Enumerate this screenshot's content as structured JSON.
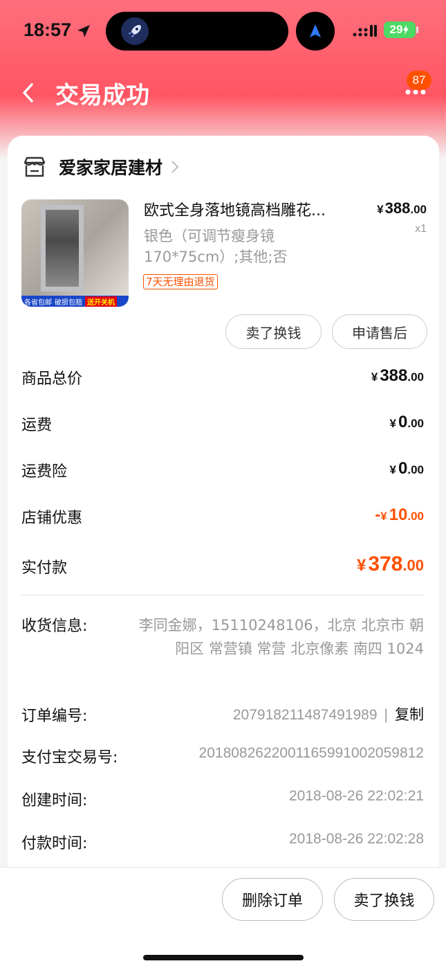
{
  "status_bar": {
    "time": "18:57",
    "battery": "29"
  },
  "header": {
    "title": "交易成功",
    "badge_count": "87"
  },
  "shop": {
    "name": "爱家家居建材"
  },
  "product": {
    "title": "欧式全身落地镜高档雕花...",
    "price_currency": "¥",
    "price_int": "388",
    "price_dec": ".00",
    "quantity": "x1",
    "spec": "银色（可调节瘦身镜170*75cm）;其他;否",
    "return_tag": "7天无理由退货",
    "image_strip": [
      "各省包邮",
      "破损包赔",
      "送开关机"
    ],
    "actions": {
      "sell": "卖了换钱",
      "after_sale": "申请售后"
    }
  },
  "fees": [
    {
      "label": "商品总价",
      "prefix": "",
      "currency": "¥",
      "int": "388",
      "dec": ".00"
    },
    {
      "label": "运费",
      "prefix": "",
      "currency": "¥",
      "int": "0",
      "dec": ".00"
    },
    {
      "label": "运费险",
      "prefix": "",
      "currency": "¥",
      "int": "0",
      "dec": ".00"
    },
    {
      "label": "店铺优惠",
      "prefix": "-",
      "currency": "¥",
      "int": "10",
      "dec": ".00"
    },
    {
      "label": "实付款",
      "prefix": "",
      "currency": "¥",
      "int": "378",
      "dec": ".00"
    }
  ],
  "info": {
    "address_label": "收货信息:",
    "address_value": "李同金娜，15110248106，北京 北京市 朝阳区 常营镇 常营 北京像素 南四 1024",
    "order_label": "订单编号:",
    "order_value": "207918211487491989",
    "copy_label": "复制",
    "alipay_label": "支付宝交易号:",
    "alipay_value": "2018082622001165991002059812",
    "created_label": "创建时间:",
    "created_value": "2018-08-26 22:02:21",
    "paid_label": "付款时间:",
    "paid_value": "2018-08-26 22:02:28"
  },
  "bottom": {
    "delete": "删除订单",
    "sell": "卖了换钱"
  },
  "colors": {
    "accent": "#ff5000",
    "header": "#ff5563"
  }
}
